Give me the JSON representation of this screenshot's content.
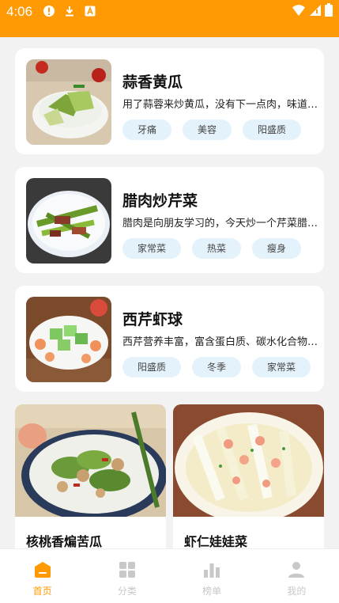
{
  "status_bar": {
    "time": "4:06"
  },
  "cards": [
    {
      "title": "蒜香黄瓜",
      "desc": "用了蒜蓉来炒黄瓜，没有下一点肉，味道却十分鲜美",
      "tags": [
        "牙痛",
        "美容",
        "阳盛质"
      ]
    },
    {
      "title": "腊肉炒芹菜",
      "desc": "腊肉是向朋友学习的，今天炒一个芹菜腊肉给大家",
      "tags": [
        "家常菜",
        "热菜",
        "瘦身"
      ]
    },
    {
      "title": "西芹虾球",
      "desc": "西芹营养丰富，富含蛋白质、碳水化合物、矿物质",
      "tags": [
        "阳盛质",
        "冬季",
        "家常菜"
      ]
    }
  ],
  "grid": [
    {
      "title": "核桃香煸苦瓜"
    },
    {
      "title": "虾仁娃娃菜"
    }
  ],
  "tabs": [
    {
      "label": "首页",
      "icon": "home-icon",
      "active": true
    },
    {
      "label": "分类",
      "icon": "grid-icon",
      "active": false
    },
    {
      "label": "榜单",
      "icon": "chart-icon",
      "active": false
    },
    {
      "label": "我的",
      "icon": "user-icon",
      "active": false
    }
  ],
  "colors": {
    "accent": "#ff9a05",
    "tag_bg": "#e4f2fb",
    "inactive": "#c8c8c8"
  }
}
